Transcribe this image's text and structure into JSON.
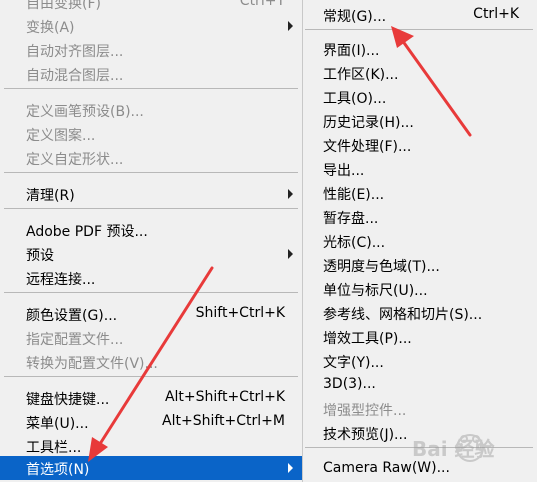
{
  "main_menu": {
    "items": [
      {
        "label": "自由变换(F)",
        "shortcut": "Ctrl+T",
        "disabled": true
      },
      {
        "label": "变换(A)",
        "disabled": true,
        "submenu": true
      },
      {
        "label": "自动对齐图层...",
        "disabled": true
      },
      {
        "label": "自动混合图层...",
        "disabled": true
      },
      {
        "label": "定义画笔预设(B)...",
        "disabled": true
      },
      {
        "label": "定义图案...",
        "disabled": true
      },
      {
        "label": "定义自定形状...",
        "disabled": true
      },
      {
        "label": "清理(R)",
        "submenu": true
      },
      {
        "label": "Adobe PDF 预设..."
      },
      {
        "label": "预设",
        "submenu": true
      },
      {
        "label": "远程连接..."
      },
      {
        "label": "颜色设置(G)...",
        "shortcut": "Shift+Ctrl+K"
      },
      {
        "label": "指定配置文件...",
        "disabled": true
      },
      {
        "label": "转换为配置文件(V)...",
        "disabled": true
      },
      {
        "label": "键盘快捷键...",
        "shortcut": "Alt+Shift+Ctrl+K"
      },
      {
        "label": "菜单(U)...",
        "shortcut": "Alt+Shift+Ctrl+M"
      },
      {
        "label": "工具栏..."
      },
      {
        "label": "首选项(N)",
        "submenu": true,
        "highlighted": true
      }
    ]
  },
  "sub_menu": {
    "items": [
      {
        "label": "常规(G)...",
        "shortcut": "Ctrl+K"
      },
      {
        "label": "界面(I)..."
      },
      {
        "label": "工作区(K)..."
      },
      {
        "label": "工具(O)..."
      },
      {
        "label": "历史记录(H)..."
      },
      {
        "label": "文件处理(F)..."
      },
      {
        "label": "导出..."
      },
      {
        "label": "性能(E)..."
      },
      {
        "label": "暂存盘..."
      },
      {
        "label": "光标(C)..."
      },
      {
        "label": "透明度与色域(T)..."
      },
      {
        "label": "单位与标尺(U)..."
      },
      {
        "label": "参考线、网格和切片(S)..."
      },
      {
        "label": "增效工具(P)..."
      },
      {
        "label": "文字(Y)..."
      },
      {
        "label": "3D(3)..."
      },
      {
        "label": "增强型控件...",
        "disabled": true
      },
      {
        "label": "技术预览(J)..."
      },
      {
        "label": "Camera Raw(W)..."
      }
    ]
  },
  "watermark": {
    "text": "Bai 经验"
  },
  "colors": {
    "highlight": "#0a64c8",
    "annotation_arrow": "#e83a3a",
    "disabled_text": "#8c8c8c"
  }
}
